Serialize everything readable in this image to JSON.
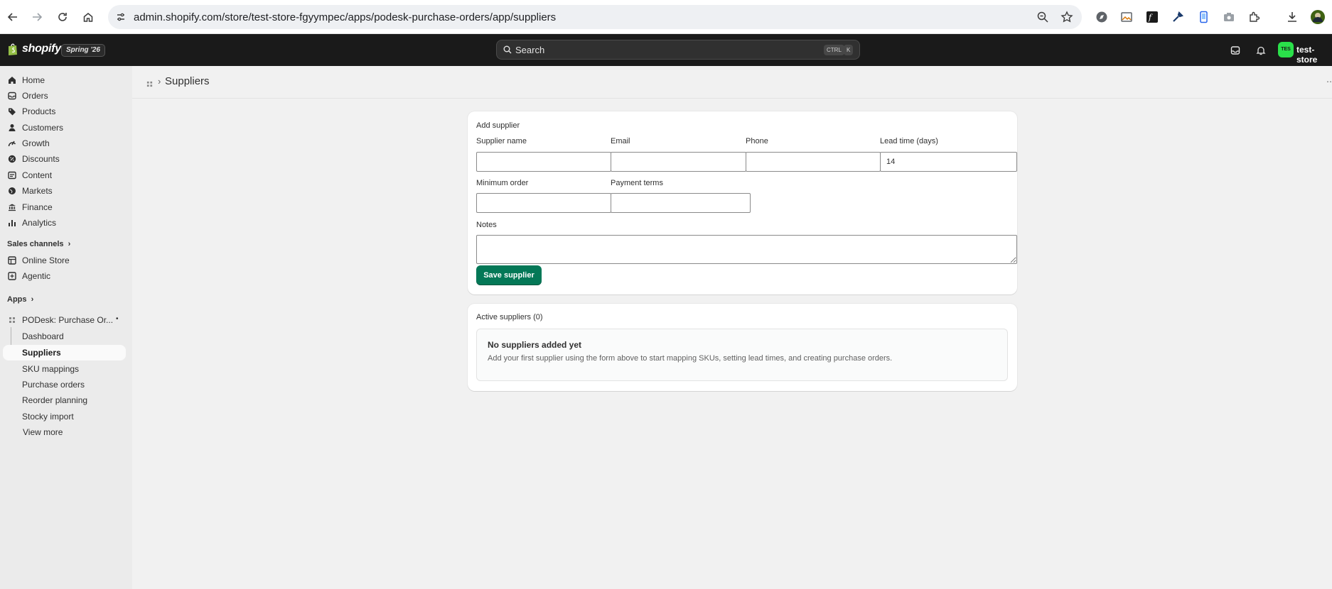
{
  "browser": {
    "url": "admin.shopify.com/store/test-store-fgyympec/apps/podesk-purchase-orders/app/suppliers"
  },
  "topbar": {
    "brand": "shopify",
    "edition": "Spring '26",
    "search_placeholder": "Search",
    "shortcut_ctrl": "CTRL",
    "shortcut_key": "K",
    "store_initials": "TES",
    "store_name": "test-store"
  },
  "sidebar": {
    "items": [
      {
        "label": "Home",
        "icon": "home-icon"
      },
      {
        "label": "Orders",
        "icon": "orders-icon"
      },
      {
        "label": "Products",
        "icon": "tag-icon"
      },
      {
        "label": "Customers",
        "icon": "person-icon"
      },
      {
        "label": "Growth",
        "icon": "growth-icon"
      },
      {
        "label": "Discounts",
        "icon": "discount-icon"
      },
      {
        "label": "Content",
        "icon": "content-icon"
      },
      {
        "label": "Markets",
        "icon": "globe-icon"
      },
      {
        "label": "Finance",
        "icon": "bank-icon"
      },
      {
        "label": "Analytics",
        "icon": "bar-chart-icon"
      }
    ],
    "sales_channels_title": "Sales channels",
    "channels": [
      {
        "label": "Online Store",
        "icon": "store-icon"
      },
      {
        "label": "Agentic",
        "icon": "agentic-icon"
      }
    ],
    "apps_title": "Apps",
    "app_name": "PODesk: Purchase Or...",
    "app_subitems": [
      "Dashboard",
      "Suppliers",
      "SKU mappings",
      "Purchase orders",
      "Reorder planning",
      "Stocky import"
    ],
    "view_more": "View more"
  },
  "page": {
    "title": "Suppliers",
    "breadcrumb_sep": "›"
  },
  "add_supplier": {
    "title": "Add supplier",
    "supplier_name_label": "Supplier name",
    "email_label": "Email",
    "phone_label": "Phone",
    "lead_time_label": "Lead time (days)",
    "lead_time_value": "14",
    "minimum_order_label": "Minimum order",
    "payment_terms_label": "Payment terms",
    "notes_label": "Notes",
    "save_label": "Save supplier"
  },
  "active_suppliers": {
    "title": "Active suppliers (0)",
    "empty_title": "No suppliers added yet",
    "empty_text": "Add your first supplier using the form above to start mapping SKUs, setting lead times, and creating purchase orders."
  },
  "colors": {
    "primary_button": "#047857",
    "topbar": "#1a1a1a",
    "store_avatar": "#2ae04a"
  }
}
